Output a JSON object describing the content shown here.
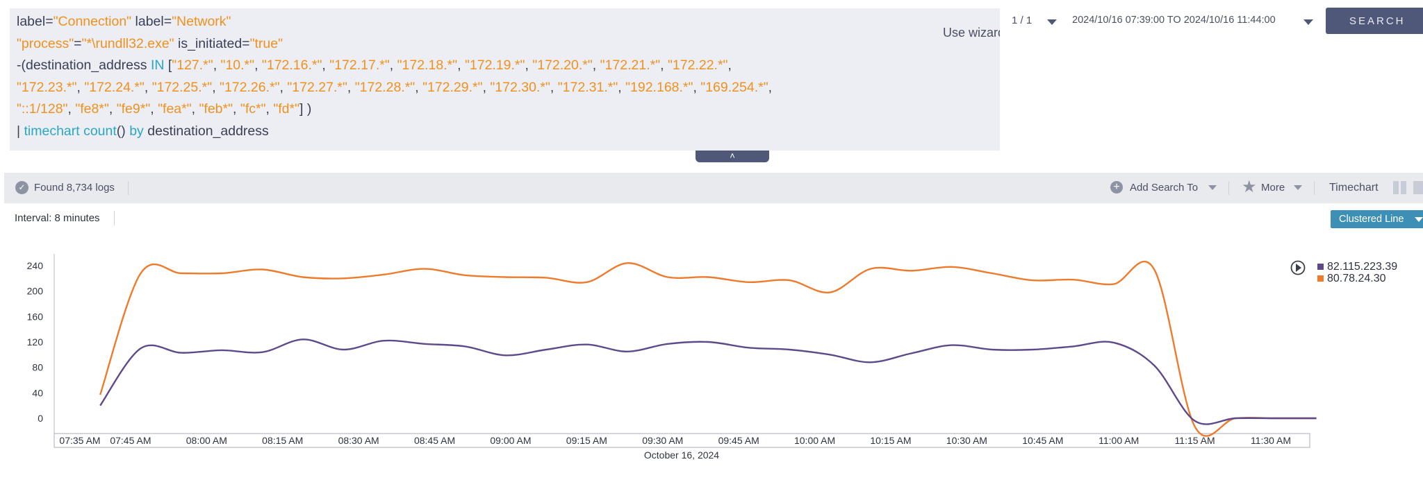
{
  "query": {
    "line1": [
      {
        "t": "label=",
        "c": "k"
      },
      {
        "t": "\"Connection\"",
        "c": "s"
      },
      {
        "t": " label=",
        "c": "k"
      },
      {
        "t": "\"Network\"",
        "c": "s"
      }
    ],
    "line2": [
      {
        "t": "\"process\"",
        "c": "s"
      },
      {
        "t": "=",
        "c": "k"
      },
      {
        "t": "\"*\\rundll32.exe\"",
        "c": "s"
      },
      {
        "t": " is_initiated=",
        "c": "k"
      },
      {
        "t": "\"true\"",
        "c": "s"
      }
    ],
    "line3": [
      {
        "t": "-(destination_address ",
        "c": "k"
      },
      {
        "t": "IN",
        "c": "f"
      },
      {
        "t": " [",
        "c": "k"
      },
      {
        "t": "\"127.*\"",
        "c": "s"
      },
      {
        "t": ", ",
        "c": "k"
      },
      {
        "t": "\"10.*\"",
        "c": "s"
      },
      {
        "t": ", ",
        "c": "k"
      },
      {
        "t": "\"172.16.*\"",
        "c": "s"
      },
      {
        "t": ", ",
        "c": "k"
      },
      {
        "t": "\"172.17.*\"",
        "c": "s"
      },
      {
        "t": ", ",
        "c": "k"
      },
      {
        "t": "\"172.18.*\"",
        "c": "s"
      },
      {
        "t": ", ",
        "c": "k"
      },
      {
        "t": "\"172.19.*\"",
        "c": "s"
      },
      {
        "t": ", ",
        "c": "k"
      },
      {
        "t": "\"172.20.*\"",
        "c": "s"
      },
      {
        "t": ", ",
        "c": "k"
      },
      {
        "t": "\"172.21.*\"",
        "c": "s"
      },
      {
        "t": ", ",
        "c": "k"
      },
      {
        "t": "\"172.22.*\"",
        "c": "s"
      },
      {
        "t": ",",
        "c": "k"
      }
    ],
    "line4": [
      {
        "t": "\"172.23.*\"",
        "c": "s"
      },
      {
        "t": ", ",
        "c": "k"
      },
      {
        "t": "\"172.24.*\"",
        "c": "s"
      },
      {
        "t": ", ",
        "c": "k"
      },
      {
        "t": "\"172.25.*\"",
        "c": "s"
      },
      {
        "t": ", ",
        "c": "k"
      },
      {
        "t": "\"172.26.*\"",
        "c": "s"
      },
      {
        "t": ", ",
        "c": "k"
      },
      {
        "t": "\"172.27.*\"",
        "c": "s"
      },
      {
        "t": ", ",
        "c": "k"
      },
      {
        "t": "\"172.28.*\"",
        "c": "s"
      },
      {
        "t": ", ",
        "c": "k"
      },
      {
        "t": "\"172.29.*\"",
        "c": "s"
      },
      {
        "t": ", ",
        "c": "k"
      },
      {
        "t": "\"172.30.*\"",
        "c": "s"
      },
      {
        "t": ", ",
        "c": "k"
      },
      {
        "t": "\"172.31.*\"",
        "c": "s"
      },
      {
        "t": ", ",
        "c": "k"
      },
      {
        "t": "\"192.168.*\"",
        "c": "s"
      },
      {
        "t": ", ",
        "c": "k"
      },
      {
        "t": "\"169.254.*\"",
        "c": "s"
      },
      {
        "t": ",",
        "c": "k"
      }
    ],
    "line5": [
      {
        "t": "\"::1/128\"",
        "c": "s"
      },
      {
        "t": ", ",
        "c": "k"
      },
      {
        "t": "\"fe8*\"",
        "c": "s"
      },
      {
        "t": ", ",
        "c": "k"
      },
      {
        "t": "\"fe9*\"",
        "c": "s"
      },
      {
        "t": ", ",
        "c": "k"
      },
      {
        "t": "\"fea*\"",
        "c": "s"
      },
      {
        "t": ", ",
        "c": "k"
      },
      {
        "t": "\"feb*\"",
        "c": "s"
      },
      {
        "t": ", ",
        "c": "k"
      },
      {
        "t": "\"fc*\"",
        "c": "s"
      },
      {
        "t": ", ",
        "c": "k"
      },
      {
        "t": "\"fd*\"",
        "c": "s"
      },
      {
        "t": "] )",
        "c": "k"
      }
    ],
    "line6": [
      {
        "t": "| ",
        "c": "k"
      },
      {
        "t": "timechart count",
        "c": "f"
      },
      {
        "t": "() ",
        "c": "k"
      },
      {
        "t": "by",
        "c": "f"
      },
      {
        "t": " destination_address",
        "c": "k"
      }
    ]
  },
  "toolbar": {
    "use_wizard": "Use wizard",
    "page_count": "1 / 1",
    "time_range": "2024/10/16 07:39:00 TO 2024/10/16 11:44:00",
    "search_label": "SEARCH"
  },
  "results": {
    "found": "Found 8,734 logs",
    "add_search_to": "Add Search To",
    "more": "More",
    "timechart": "Timechart",
    "interval": "Interval: 8 minutes",
    "chart_type": "Clustered Line"
  },
  "colors": {
    "series_purple": "#5e4a8b",
    "series_orange": "#ee7a2c",
    "search_button": "#4f5879",
    "chart_type_select": "#3d8fb5"
  },
  "chart_data": {
    "type": "line",
    "date_label": "October 16, 2024",
    "y_ticks": [
      0,
      40,
      80,
      120,
      160,
      200,
      240
    ],
    "ylim": [
      -14,
      260
    ],
    "x_tick_labels": [
      "07:35 AM",
      "07:45 AM",
      "08:00 AM",
      "08:15 AM",
      "08:30 AM",
      "08:45 AM",
      "09:00 AM",
      "09:15 AM",
      "09:30 AM",
      "09:45 AM",
      "10:00 AM",
      "10:15 AM",
      "10:30 AM",
      "10:45 AM",
      "11:00 AM",
      "11:15 AM",
      "11:30 AM"
    ],
    "x": [
      "07:39",
      "07:47",
      "07:55",
      "08:03",
      "08:11",
      "08:19",
      "08:27",
      "08:35",
      "08:43",
      "08:51",
      "08:59",
      "09:07",
      "09:15",
      "09:23",
      "09:31",
      "09:39",
      "09:47",
      "09:55",
      "10:03",
      "10:11",
      "10:19",
      "10:27",
      "10:35",
      "10:43",
      "10:51",
      "10:59",
      "11:07",
      "11:15",
      "11:23",
      "11:31",
      "11:39"
    ],
    "legend_position": "top-right",
    "series": [
      {
        "name": "82.115.223.39",
        "color": "#5e4a8b",
        "values": [
          20,
          110,
          103,
          107,
          104,
          124,
          108,
          122,
          117,
          113,
          99,
          108,
          116,
          105,
          117,
          120,
          111,
          108,
          100,
          88,
          102,
          115,
          108,
          108,
          113,
          119,
          83,
          -4,
          0,
          0,
          0
        ]
      },
      {
        "name": "80.78.24.30",
        "color": "#ee7a2c",
        "values": [
          37,
          228,
          228,
          228,
          234,
          222,
          220,
          226,
          235,
          225,
          222,
          221,
          214,
          244,
          222,
          222,
          214,
          217,
          198,
          235,
          232,
          238,
          228,
          217,
          218,
          211,
          234,
          -13,
          0,
          0,
          0
        ]
      }
    ]
  }
}
